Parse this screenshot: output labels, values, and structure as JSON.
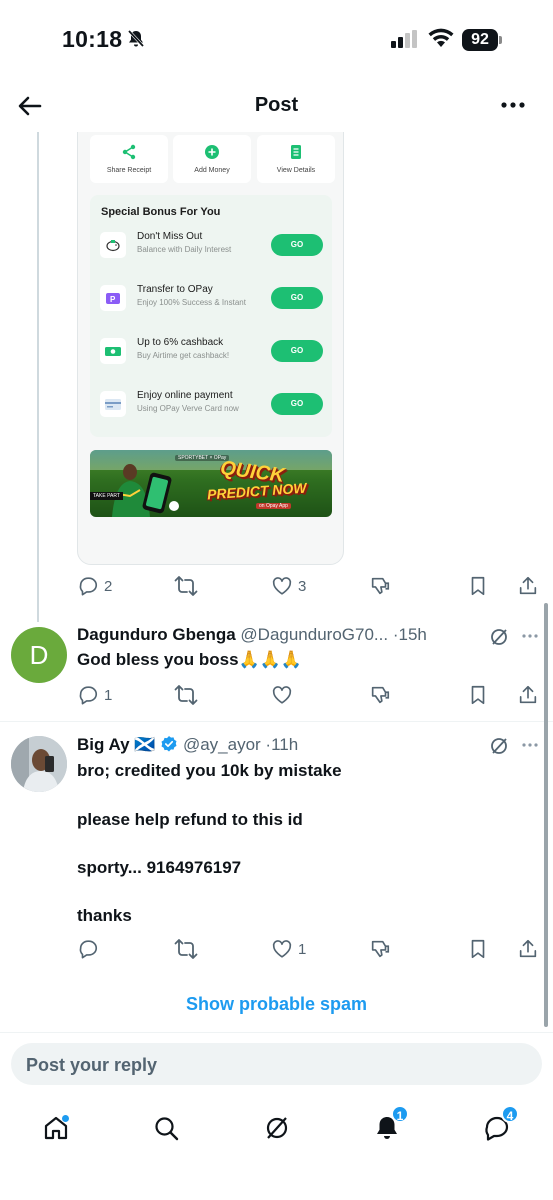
{
  "status_bar": {
    "time": "10:18",
    "battery": "92"
  },
  "header": {
    "title": "Post"
  },
  "embed": {
    "quick_actions": [
      {
        "label": "Share Receipt",
        "icon": "share-icon"
      },
      {
        "label": "Add Money",
        "icon": "plus-circle-icon"
      },
      {
        "label": "View Details",
        "icon": "document-icon"
      }
    ],
    "bonus_title": "Special Bonus For You",
    "bonus_items": [
      {
        "title": "Don't Miss Out",
        "desc": "Balance with Daily Interest",
        "button": "GO",
        "icon": "piggy-bank-icon"
      },
      {
        "title": "Transfer to OPay",
        "desc": "Enjoy 100% Success & Instant",
        "button": "GO",
        "icon": "wallet-icon"
      },
      {
        "title": "Up to 6% cashback",
        "desc": "Buy Airtime get cashback!",
        "button": "GO",
        "icon": "cash-icon"
      },
      {
        "title": "Enjoy online payment",
        "desc": "Using OPay Verve Card now",
        "button": "GO",
        "icon": "card-icon"
      }
    ],
    "banner": {
      "brand": "SPORTYBET × OPay",
      "line1": "QUICK",
      "line2": "PREDICT NOW",
      "sub": "on Opay App",
      "tag": "TAKE PART"
    }
  },
  "main_post_actions": {
    "replies": "2",
    "reposts": "",
    "likes": "3"
  },
  "replies": [
    {
      "name": "Dagunduro Gbenga",
      "handle": "@DagunduroG70...",
      "time": "15h",
      "avatar_letter": "D",
      "lines": [
        "God bless you boss🙏🙏🙏"
      ],
      "counts": {
        "replies": "1",
        "reposts": "",
        "likes": ""
      }
    },
    {
      "name": "Big Ay",
      "flag": "🏴󠁧󠁢󠁳󠁣󠁴󠁿",
      "handle": "@ay_ayor",
      "time": "11h",
      "verified": true,
      "lines": [
        "bro; credited you 10k by mistake",
        "please help refund to this id",
        "sporty... 9164976197",
        "thanks"
      ],
      "counts": {
        "replies": "",
        "reposts": "",
        "likes": "1"
      }
    }
  ],
  "spam_link": "Show probable spam",
  "composer": {
    "placeholder": "Post your reply"
  },
  "tabs": {
    "home": {
      "icon": "home-icon",
      "dot": true
    },
    "search": {
      "icon": "search-icon"
    },
    "grok": {
      "icon": "grok-icon"
    },
    "notifications": {
      "icon": "bell-icon",
      "badge": "1"
    },
    "messages": {
      "icon": "messages-icon",
      "badge": "4"
    }
  },
  "colors": {
    "accent": "#1d9bf0",
    "opay_green": "#1dbf73",
    "text_secondary": "#536471"
  }
}
